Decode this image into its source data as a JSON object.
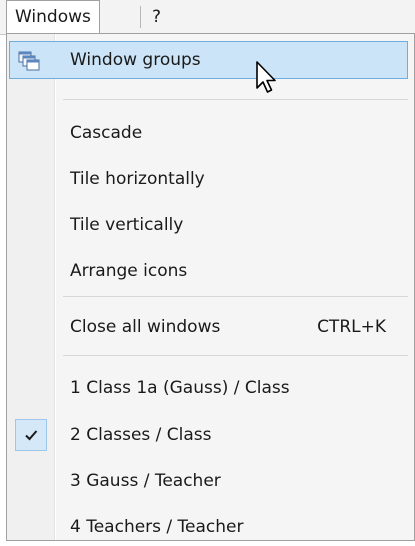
{
  "menubar": {
    "windows_label": "Windows",
    "help_label": "?"
  },
  "menu": {
    "window_groups": {
      "label": "Window groups",
      "icon": "window-groups-icon"
    },
    "cascade": {
      "label": "Cascade"
    },
    "tile_horizontally": {
      "label": "Tile horizontally"
    },
    "tile_vertically": {
      "label": "Tile vertically"
    },
    "arrange_icons": {
      "label": "Arrange icons"
    },
    "close_all": {
      "label": "Close all windows",
      "shortcut": "CTRL+K"
    },
    "windows": [
      {
        "label": "1 Class 1a (Gauss) / Class",
        "checked": false
      },
      {
        "label": "2 Classes / Class",
        "checked": true
      },
      {
        "label": "3 Gauss / Teacher",
        "checked": false
      },
      {
        "label": "4 Teachers / Teacher",
        "checked": false
      }
    ]
  },
  "colors": {
    "highlight_bg": "#cce4f7",
    "highlight_border": "#6caee0",
    "menu_bg": "#f5f5f5"
  }
}
